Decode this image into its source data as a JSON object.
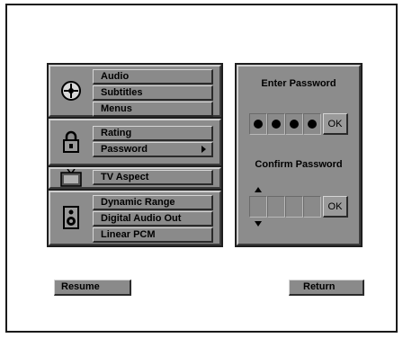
{
  "menu": {
    "audio_group": {
      "icon": "disc-icon",
      "items": [
        {
          "label": "Audio"
        },
        {
          "label": "Subtitles"
        },
        {
          "label": "Menus"
        }
      ]
    },
    "rating_group": {
      "icon": "lock-icon",
      "items": [
        {
          "label": "Rating"
        },
        {
          "label": "Password",
          "selected": true
        }
      ]
    },
    "tv_group": {
      "icon": "tv-icon",
      "items": [
        {
          "label": "TV Aspect"
        }
      ]
    },
    "audio_out_group": {
      "icon": "speaker-icon",
      "items": [
        {
          "label": "Dynamic Range"
        },
        {
          "label": "Digital Audio Out"
        },
        {
          "label": "Linear PCM"
        }
      ]
    }
  },
  "password_panel": {
    "enter_title": "Enter Password",
    "enter_ok": "OK",
    "enter_digits_filled": 4,
    "confirm_title": "Confirm Password",
    "confirm_ok": "OK",
    "confirm_digits_filled": 0
  },
  "buttons": {
    "resume": "Resume",
    "return": "Return"
  },
  "colors": {
    "panel": "#8c8c8c",
    "panel_border": "#1e1e1e",
    "text": "#000000"
  }
}
